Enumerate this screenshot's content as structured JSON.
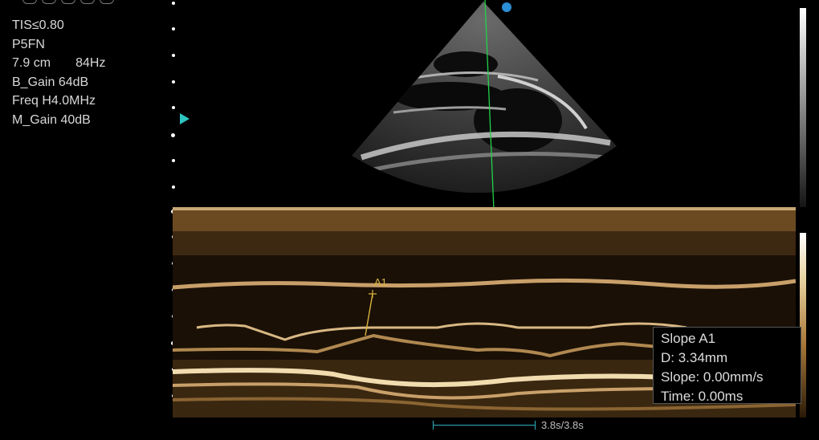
{
  "params": {
    "tis": "TIS≤0.80",
    "probe": "P5FN",
    "depth_fps": "7.9 cm       84Hz",
    "b_gain": "B_Gain 64dB",
    "freq": "Freq H4.0MHz",
    "m_gain": "M_Gain 40dB"
  },
  "cursor_label": "A1",
  "measurement": {
    "title": "Slope A1",
    "d": "D: 3.34mm",
    "slope": "Slope: 0.00mm/s",
    "time": "Time: 0.00ms"
  },
  "time_scale": {
    "label": "3.8s/3.8s"
  },
  "colors": {
    "mline": "#22d24a",
    "focus": "#2ec4c0",
    "orient": "#2a8fd6",
    "caliper": "#d8b440"
  },
  "icons": [
    "probe-icon",
    "cine-icon",
    "settings-icon",
    "hand-icon",
    "capture-icon"
  ]
}
